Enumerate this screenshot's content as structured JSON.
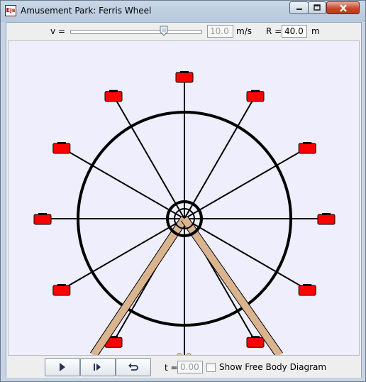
{
  "window": {
    "title": "Amusement Park: Ferris Wheel",
    "app_icon_text": "Ejs"
  },
  "controls": {
    "v_label": "v =",
    "v_value": "10.0",
    "v_unit": "m/s",
    "r_label": "R =",
    "r_value": "40.0",
    "r_unit": "m",
    "slider_level": 0.72
  },
  "bottom": {
    "t_label": "t =",
    "t_value": "0.00",
    "fbd_label": "Show Free Body Diagram",
    "fbd_checked": false,
    "buttons": [
      "play",
      "step",
      "reset"
    ]
  },
  "colors": {
    "gondola": "#ff0000",
    "passenger_car": "#0000ff",
    "support": "#d9b48f",
    "canvas_bg": "#eeeefd"
  },
  "icons": {
    "play": "play-icon",
    "step": "step-icon",
    "reset": "reset-icon",
    "minimize": "minimize-icon",
    "maximize": "maximize-icon",
    "close": "close-icon"
  }
}
